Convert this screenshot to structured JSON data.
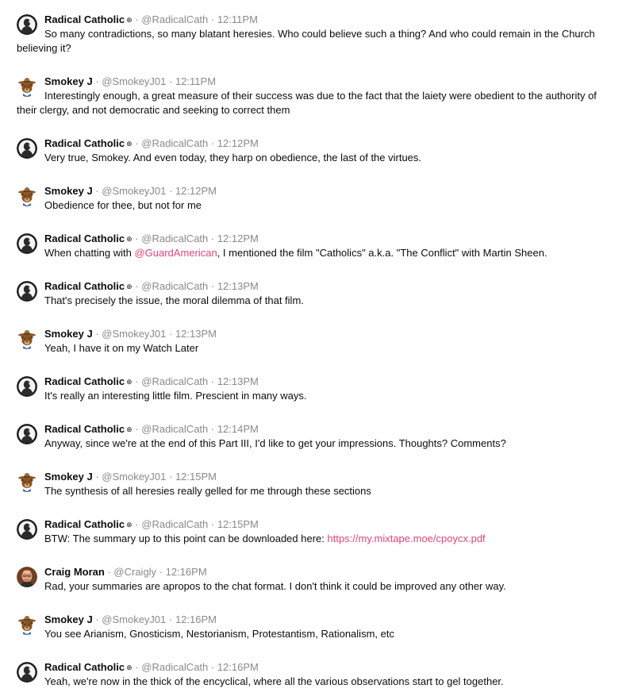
{
  "users": {
    "radical": {
      "name": "Radical Catholic",
      "badge": "⊕",
      "handle": "@RadicalCath",
      "avatar_icon": "pope-portrait-avatar"
    },
    "smokey": {
      "name": "Smokey J",
      "badge": "",
      "handle": "@SmokeyJ01",
      "avatar_icon": "smokey-bear-avatar"
    },
    "craig": {
      "name": "Craig Moran",
      "badge": "",
      "handle": "@Craigly",
      "avatar_icon": "bald-man-avatar"
    }
  },
  "separator": " · ",
  "colors": {
    "mention": "#e3447a",
    "meta": "#8a8a8a",
    "text": "#0c0c0c"
  },
  "messages": [
    {
      "user": "radical",
      "time": "12:11PM",
      "text": "So many contradictions, so many blatant heresies. Who could believe such a thing? And who could remain in the Church believing it?"
    },
    {
      "user": "smokey",
      "time": "12:11PM",
      "text": "Interestingly enough, a great measure of their success was due to the fact that the laiety were obedient to the authority of their clergy, and not democratic and seeking to correct them"
    },
    {
      "user": "radical",
      "time": "12:12PM",
      "text": "Very true, Smokey. And even today, they harp on obedience, the last of the virtues."
    },
    {
      "user": "smokey",
      "time": "12:12PM",
      "text": "Obedience for thee, but not for me"
    },
    {
      "user": "radical",
      "time": "12:12PM",
      "text_before": "When chatting with ",
      "mention": "@GuardAmerican",
      "text_after": ", I mentioned the film \"Catholics\" a.k.a. \"The Conflict\" with Martin Sheen."
    },
    {
      "user": "radical",
      "time": "12:13PM",
      "text": "That's precisely the issue, the moral dilemma of that film."
    },
    {
      "user": "smokey",
      "time": "12:13PM",
      "text": "Yeah, I have it on my Watch Later"
    },
    {
      "user": "radical",
      "time": "12:13PM",
      "text": "It's really an interesting little film. Prescient in many ways."
    },
    {
      "user": "radical",
      "time": "12:14PM",
      "text": "Anyway, since we're at the end of this Part III, I'd like to get your impressions. Thoughts? Comments?"
    },
    {
      "user": "smokey",
      "time": "12:15PM",
      "text": "The synthesis of all heresies really gelled for me through these sections"
    },
    {
      "user": "radical",
      "time": "12:15PM",
      "text_before": "BTW: The summary up to this point can be downloaded here: ",
      "link": "https://my.mixtape.moe/cpoycx.pdf",
      "text_after": ""
    },
    {
      "user": "craig",
      "time": "12:16PM",
      "text": "Rad, your summaries are apropos to the chat format. I don't think it could be improved any other way."
    },
    {
      "user": "smokey",
      "time": "12:16PM",
      "text": "You see Arianism, Gnosticism, Nestorianism, Protestantism, Rationalism, etc"
    },
    {
      "user": "radical",
      "time": "12:16PM",
      "text": "Yeah, we're now in the thick of the encyclical, where all the various observations start to gel together."
    }
  ]
}
